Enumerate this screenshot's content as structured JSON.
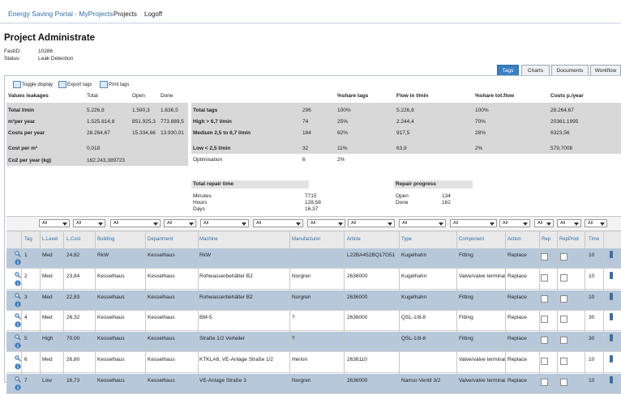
{
  "header": {
    "brand": "Energy Saving Portal - MyProjects",
    "nav": [
      "Projects",
      "Logoff"
    ]
  },
  "page": {
    "title": "Project Administrate",
    "fields": [
      {
        "label": "FastID:",
        "value": "10286"
      },
      {
        "label": "Status:",
        "value": "Leak Detection"
      }
    ]
  },
  "tabs": [
    "Tags",
    "Charts",
    "Documents",
    "Workflow"
  ],
  "toolbar": [
    "Toggle display",
    "Export tags",
    "Print tags"
  ],
  "values": {
    "headers": [
      "Values leakages",
      "Total",
      "Open",
      "Done"
    ],
    "rows": [
      [
        "Total l/min",
        "5.226,8",
        "1.590,3",
        "1.636,5"
      ],
      [
        "m³per year",
        "1.525.814,8",
        "851.925,3",
        "773.889,5"
      ],
      [
        "Costs per year",
        "28.264,67",
        "15.334,66",
        "13.930,01"
      ],
      [
        "Cost per m³",
        "0,018",
        "",
        ""
      ],
      [
        "Co2 per year (kg)",
        "162.243,389723",
        "",
        ""
      ]
    ]
  },
  "tags_summary": {
    "headers": [
      "",
      "",
      "%share tags",
      "Flow in l/min",
      "%share tot.flow",
      "Costs p./year"
    ],
    "rows": [
      [
        "Total tags",
        "296",
        "100%",
        "5.226,8",
        "100%",
        "28.264,67"
      ],
      [
        "High > 6,7 l/min",
        "74",
        "25%",
        "2.244,4",
        "70%",
        "20361.1995"
      ],
      [
        "Medium 2,5 to 6,7 l/min",
        "184",
        "62%",
        "917,5",
        "28%",
        "6323,56"
      ],
      [
        "Low < 2,5 l/min",
        "32",
        "11%",
        "63,9",
        "2%",
        "579,7008"
      ],
      [
        "Optimisation",
        "6",
        "2%",
        "",
        "",
        ""
      ]
    ]
  },
  "repair_time": {
    "title": "Total repair time",
    "rows": [
      [
        "Minutes",
        "7715"
      ],
      [
        "Hours",
        "128,58"
      ],
      [
        "Days",
        "16,37"
      ]
    ]
  },
  "repair_progress": {
    "title": "Repair progress",
    "rows": [
      [
        "Open",
        "134"
      ],
      [
        "Done",
        "162"
      ]
    ]
  },
  "filters": [
    "All",
    "All",
    "All",
    "All",
    "All",
    "All",
    "All",
    "All",
    "All",
    "All",
    "All",
    "All",
    "All",
    "All"
  ],
  "table": {
    "columns": [
      "Tag",
      "L.Level",
      "L.Cost",
      "Building",
      "Department",
      "Machine",
      "Manufacturer",
      "Article",
      "Type",
      "Component",
      "Action",
      "Rep",
      "RepProd",
      "Time"
    ],
    "rows": [
      [
        "1",
        "Med",
        "24,82",
        "RkW",
        "Kesselhaus",
        "RkW",
        "",
        "L22BA452BQ17G51",
        "Kugelhahn",
        "Fitting",
        "Replace",
        "",
        "",
        "10"
      ],
      [
        "2",
        "Med",
        "23,84",
        "Kesselhaus",
        "Kesselhaus",
        "Rohwasserbehälter B2",
        "Norgren",
        "2636000",
        "Kugelhahn",
        "Valve/valve terminal",
        "Replace",
        "",
        "",
        "10"
      ],
      [
        "3",
        "Med",
        "22,83",
        "Kesselhaus",
        "Kesselhaus",
        "Rohwasserbehälter B2",
        "Norgren",
        "2636000",
        "Kugelhahn",
        "Fitting",
        "Replace",
        "",
        "",
        "10"
      ],
      [
        "4",
        "Med",
        "26,32",
        "Kesselhaus",
        "Kesselhaus",
        "BM-5",
        "?",
        "2636000",
        "QSL-1/8-8",
        "Fitting",
        "Replace",
        "",
        "",
        "30"
      ],
      [
        "5",
        "High",
        "70,00",
        "Kesselhaus",
        "Kesselhaus",
        "Straße 1/2 Verteiler",
        "?",
        "",
        "QSL-1/8-8",
        "Fitting",
        "Replace",
        "",
        "",
        "30"
      ],
      [
        "6",
        "Med",
        "26,80",
        "Kesselhaus",
        "Kesselhaus",
        "KTKLA6, VE-Anlage Straße 1/2",
        "Herion",
        "2636110",
        "",
        "Valve/valve terminal",
        "Replace",
        "",
        "",
        "10"
      ],
      [
        "7",
        "Low",
        "16,73",
        "Kesselhaus",
        "Kesselhaus",
        "VE-Anlage Straße 3",
        "Norgren",
        "2636000",
        "Namur-Ventil 3/2",
        "Valve/valve terminal",
        "Replace",
        "",
        "",
        "10"
      ]
    ]
  }
}
